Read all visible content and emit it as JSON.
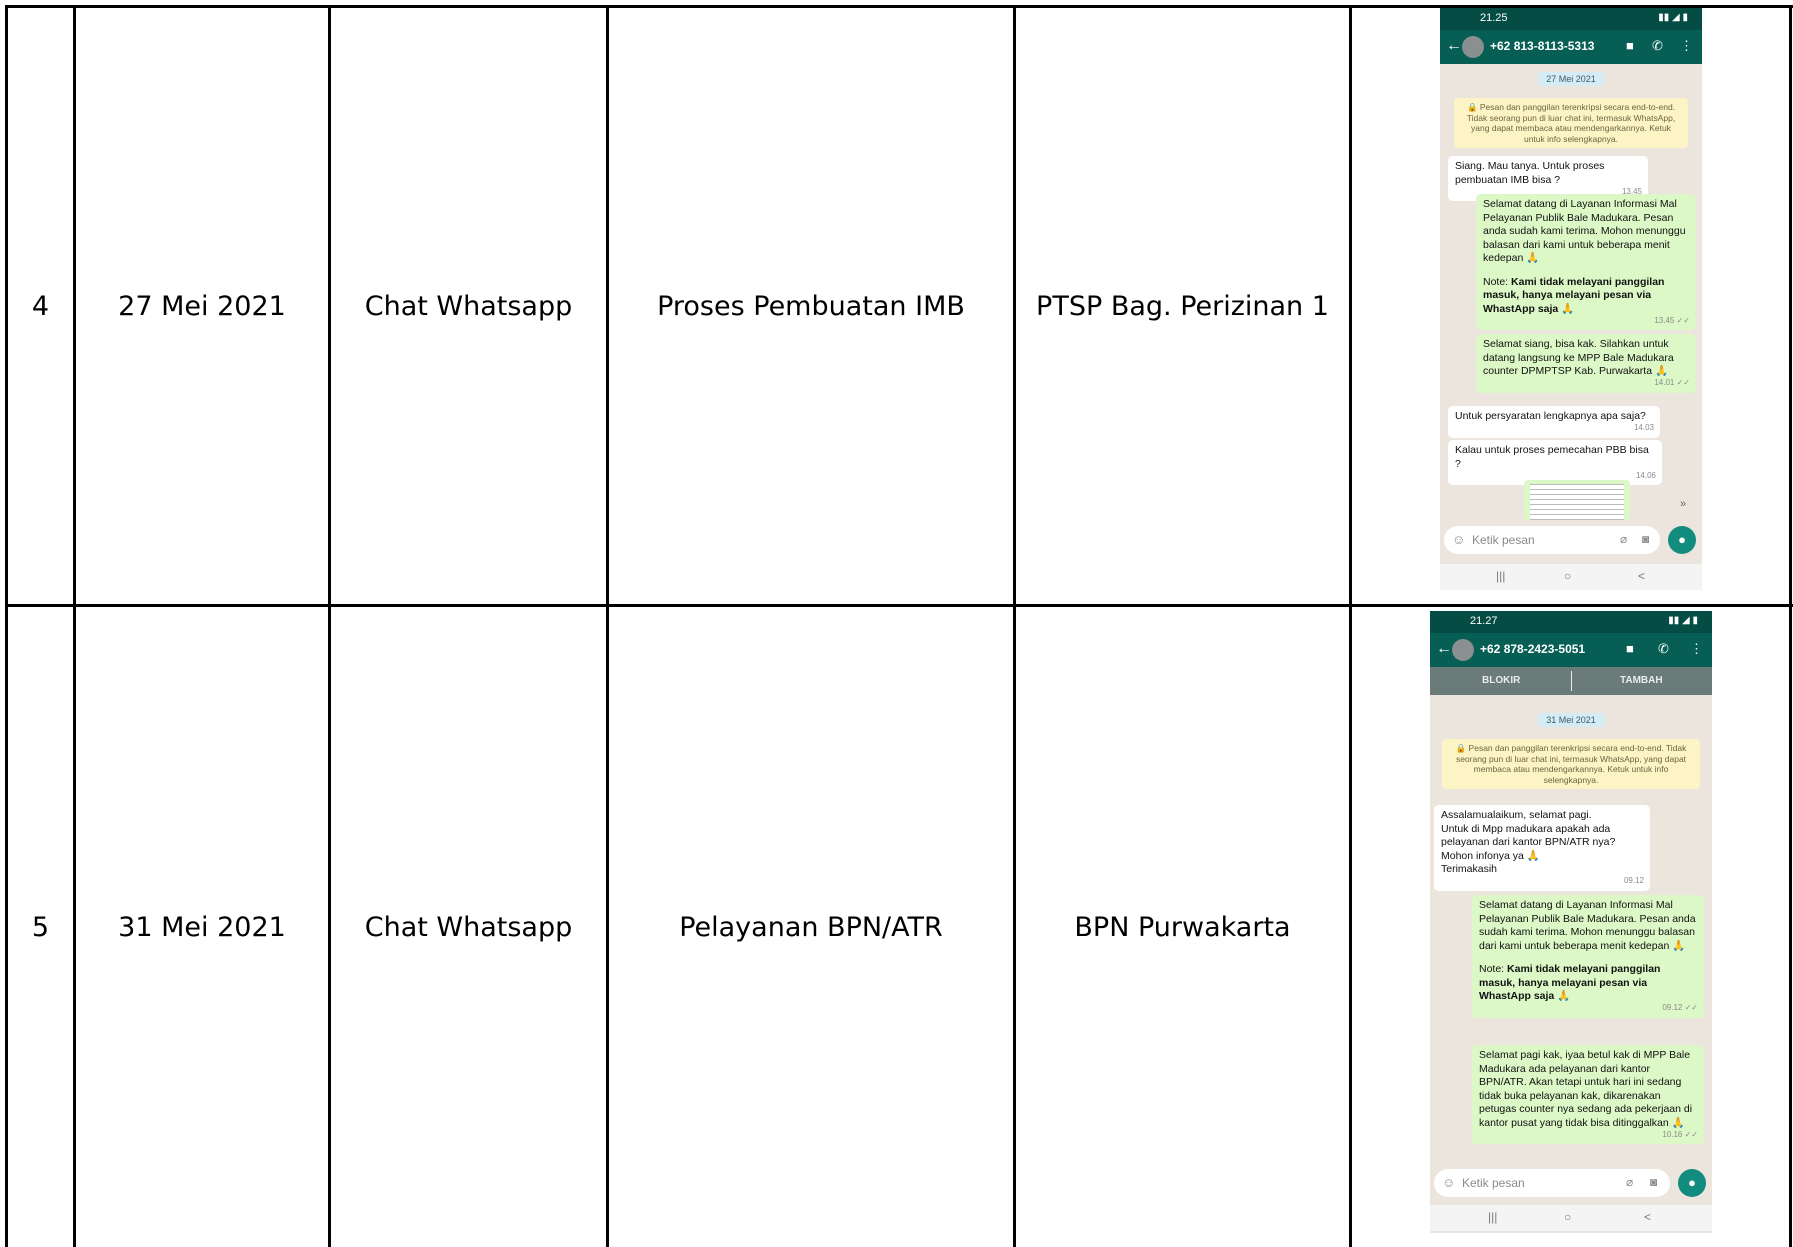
{
  "rows": [
    {
      "no": "4",
      "date": "27 Mei 2021",
      "channel": "Chat Whatsapp",
      "subject": "Proses Pembuatan IMB",
      "handler": "PTSP Bag. Perizinan 1",
      "screenshot": {
        "status_time": "21.25",
        "contact": "+62 813-8113-5313",
        "date_chip": "27 Mei 2021",
        "encryption_notice": "🔒 Pesan dan panggilan terenkripsi secara end-to-end. Tidak seorang pun di luar chat ini, termasuk WhatsApp, yang dapat membaca atau mendengarkannya. Ketuk untuk info selengkapnya.",
        "messages": [
          {
            "text": "Siang. Mau tanya. Untuk proses pembuatan IMB bisa ?",
            "time": "13.45"
          },
          {
            "text": "Selamat datang di Layanan Informasi Mal Pelayanan Publik Bale Madukara. Pesan anda sudah kami terima. Mohon menunggu balasan dari kami untuk beberapa menit kedepan 🙏",
            "note_prefix": "Note: ",
            "note_bold": "Kami tidak melayani panggilan masuk, hanya melayani pesan via WhastApp saja 🙏",
            "time": "13.45 ✓✓"
          },
          {
            "text": "Selamat siang, bisa kak. Silahkan untuk datang langsung ke MPP Bale Madukara counter DPMPTSP Kab. Purwakarta 🙏",
            "time": "14.01 ✓✓"
          },
          {
            "text": "Untuk persyaratan lengkapnya apa saja?",
            "time": "14.03"
          },
          {
            "text": "Kalau untuk proses pemecahan PBB bisa ?",
            "time": "14.06"
          }
        ],
        "compose_placeholder": "Ketik pesan"
      }
    },
    {
      "no": "5",
      "date": "31 Mei 2021",
      "channel": "Chat Whatsapp",
      "subject": "Pelayanan BPN/ATR",
      "handler": "BPN Purwakarta",
      "screenshot": {
        "status_time": "21.27",
        "contact": "+62 878-2423-5051",
        "block_label": "BLOKIR",
        "add_label": "TAMBAH",
        "date_chip": "31 Mei 2021",
        "encryption_notice": "🔒 Pesan dan panggilan terenkripsi secara end-to-end. Tidak seorang pun di luar chat ini, termasuk WhatsApp, yang dapat membaca atau mendengarkannya. Ketuk untuk info selengkapnya.",
        "messages": [
          {
            "text": "Assalamualaikum, selamat pagi.\nUntuk di Mpp madukara apakah ada pelayanan dari kantor BPN/ATR nya?\nMohon infonya ya 🙏\nTerimakasih",
            "time": "09.12"
          },
          {
            "text": "Selamat datang di Layanan Informasi Mal Pelayanan Publik Bale Madukara. Pesan anda sudah kami terima. Mohon menunggu balasan dari kami untuk beberapa menit kedepan 🙏",
            "note_prefix": "Note: ",
            "note_bold": "Kami tidak melayani panggilan masuk, hanya melayani pesan via WhastApp saja 🙏",
            "time": "09.12 ✓✓"
          },
          {
            "text": "Selamat pagi kak, iyaa betul kak di MPP Bale Madukara ada pelayanan dari kantor BPN/ATR. Akan tetapi untuk hari ini sedang tidak buka pelayanan kak, dikarenakan petugas counter nya sedang ada pekerjaan di kantor pusat yang tidak bisa ditinggalkan 🙏",
            "time": "10.16 ✓✓"
          }
        ],
        "compose_placeholder": "Ketik pesan"
      }
    }
  ]
}
